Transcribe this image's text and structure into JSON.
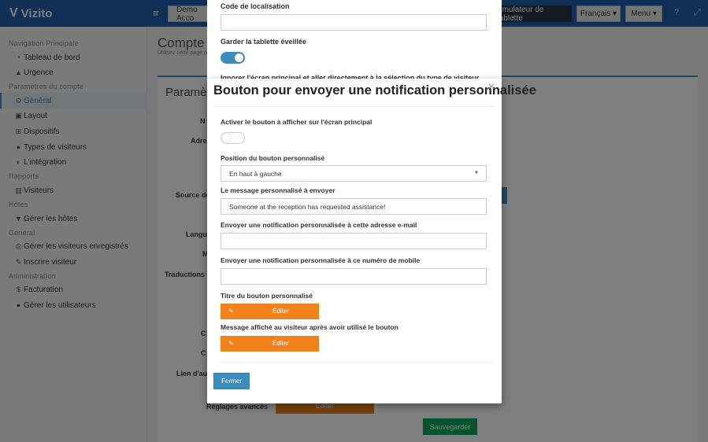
{
  "topbar": {
    "logo_mark": "V",
    "logo_text": "Vizito",
    "hamburger_glyph": "≡",
    "account_button": "Demo Acco",
    "tablet_emulator_button": "Émulateur de tablette",
    "language_button": "Français ▾",
    "menu_button": "Menu ▾",
    "help_glyph": "?",
    "expand_glyph": "⤢"
  },
  "sidebar": {
    "sections": [
      {
        "title": "Navigation Principale"
      },
      {
        "title": "Paramètres du compte"
      },
      {
        "title": "Rapports"
      },
      {
        "title": "Hôtes"
      },
      {
        "title": "Général"
      },
      {
        "title": "Administration"
      }
    ],
    "items": [
      {
        "label": "Tableau de bord",
        "icon": "◔"
      },
      {
        "label": "Urgence",
        "icon": "▲"
      },
      {
        "label": "Général",
        "icon": "⚙"
      },
      {
        "label": "Layout",
        "icon": "▣"
      },
      {
        "label": "Dispositifs",
        "icon": "⊞"
      },
      {
        "label": "Types de visiteurs",
        "icon": "●"
      },
      {
        "label": "L'intégration",
        "icon": "◐"
      },
      {
        "label": "Visiteurs",
        "icon": "▥"
      },
      {
        "label": "Gérer les hôtes",
        "icon": "▼"
      },
      {
        "label": "Gérer les visiteurs enregistrés",
        "icon": "◎"
      },
      {
        "label": "Inscrire visiteur",
        "icon": "✎"
      },
      {
        "label": "Facturation",
        "icon": "$"
      },
      {
        "label": "Gérer les utilisateurs",
        "icon": "●"
      }
    ]
  },
  "main": {
    "page_title": "Compte",
    "page_subtitle": "Utilisez cette page p",
    "panel_title": "Paramèt",
    "background_labels": [
      "N",
      "Adres",
      "Source de",
      "Langu",
      "M",
      "Traductions g",
      "C",
      "C",
      "Lien d'aut",
      "Réglages avancés"
    ],
    "background_edit_label": "Éditer",
    "save_button": "Sauvegarder"
  },
  "back_modal": {
    "location_code_label": "Code de localisation",
    "keep_awake_label": "Garder la tablette éveillée",
    "ignore_screen_label": "Ignorer l'écran principal et aller directement à la sélection du type de visiteur"
  },
  "modal": {
    "title": "Bouton pour envoyer une notification personnalisée",
    "close_glyph": "×",
    "activate_label": "Activer le bouton à afficher sur l'écran principal",
    "position_label": "Position du bouton personnalisé",
    "position_value": "En haut à gauche",
    "caret_glyph": "▼",
    "message_label": "Le message personnalisé à envoyer",
    "message_value": "Someone at the reception has requested assistance!",
    "email_label": "Envoyer une notification personnalisée à cette adresse e-mail",
    "email_value": "",
    "mobile_label": "Envoyer une notification personnalisée à ce numéro de mobile",
    "mobile_value": "",
    "button_title_label": "Titre du bouton personnalisé",
    "after_message_label": "Message affiché au visiteur après avoir utilisé le bouton",
    "edit_glyph": "✎",
    "edit_label": "Éditer",
    "close_button": "Fermer"
  },
  "colors": {
    "topbar": "#1f5fa8",
    "accent": "#3c8dbc",
    "orange": "#f0811b",
    "green": "#00a65a"
  }
}
